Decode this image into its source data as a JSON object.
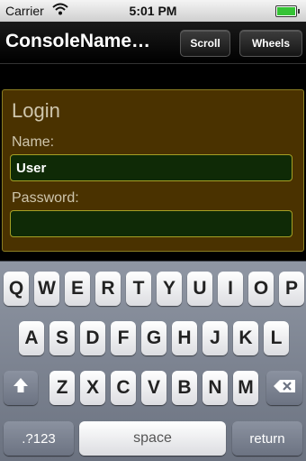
{
  "status_bar": {
    "carrier": "Carrier",
    "time": "5:01 PM",
    "wifi_icon": "wifi-icon",
    "battery_icon": "battery-icon"
  },
  "nav": {
    "title": "ConsoleName…",
    "scroll_label": "Scroll",
    "wheels_label": "Wheels"
  },
  "login": {
    "title": "Login",
    "name_label": "Name:",
    "name_value": "User",
    "password_label": "Password:",
    "password_value": ""
  },
  "keyboard": {
    "row1": [
      "Q",
      "W",
      "E",
      "R",
      "T",
      "Y",
      "U",
      "I",
      "O",
      "P"
    ],
    "row2": [
      "A",
      "S",
      "D",
      "F",
      "G",
      "H",
      "J",
      "K",
      "L"
    ],
    "row3": [
      "Z",
      "X",
      "C",
      "V",
      "B",
      "N",
      "M"
    ],
    "shift_icon": "shift-arrow-icon",
    "backspace_icon": "backspace-icon",
    "numbers_label": ".?123",
    "space_label": "space",
    "return_label": "return"
  },
  "colors": {
    "panel_bg": "#4a3200",
    "panel_border": "#8a7d22",
    "field_bg": "#0f2a06",
    "field_border": "#a5a024",
    "text_accent": "#cfc6ad"
  }
}
